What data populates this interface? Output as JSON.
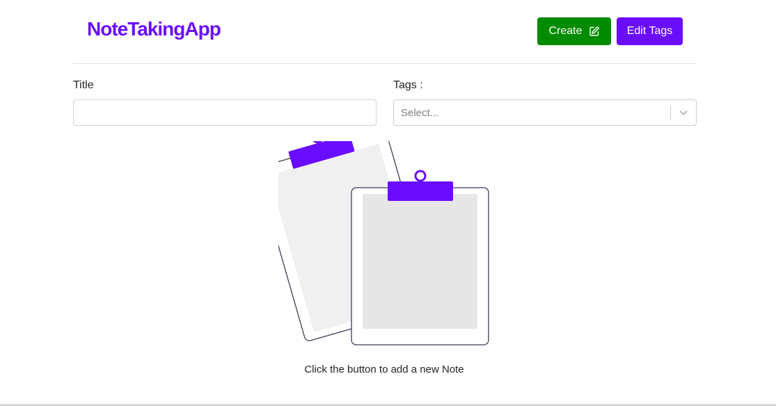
{
  "app": {
    "brand": "NoteTakingApp"
  },
  "toolbar": {
    "create_label": "Create",
    "edit_tags_label": "Edit Tags"
  },
  "form": {
    "title_label": "Title",
    "title_value": "",
    "tags_label": "Tags :",
    "tags_placeholder": "Select..."
  },
  "empty_state": {
    "message": "Click the button to add a new Note"
  },
  "colors": {
    "brand": "#6a0dff",
    "create": "#008c00",
    "edit_tags": "#6a0dff"
  },
  "icons": {
    "create": "pencil-square-icon",
    "select": "chevron-down-icon"
  }
}
